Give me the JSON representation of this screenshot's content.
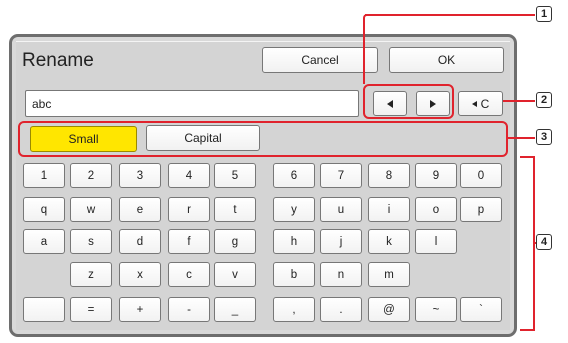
{
  "dialog": {
    "title": "Rename",
    "cancel_label": "Cancel",
    "ok_label": "OK"
  },
  "input": {
    "value": "abc"
  },
  "controls": {
    "clear_label": "C",
    "case_small_label": "Small",
    "case_capital_label": "Capital"
  },
  "keyboard": {
    "rows": [
      [
        "1",
        "2",
        "3",
        "4",
        "5",
        "6",
        "7",
        "8",
        "9",
        "0"
      ],
      [
        "q",
        "w",
        "e",
        "r",
        "t",
        "y",
        "u",
        "i",
        "o",
        "p"
      ],
      [
        "a",
        "s",
        "d",
        "f",
        "g",
        "h",
        "j",
        "k",
        "l"
      ],
      [
        "z",
        "x",
        "c",
        "v",
        "b",
        "n",
        "m"
      ],
      [
        "=",
        "+",
        "-",
        "_",
        ",",
        ".",
        "@",
        "~",
        "`"
      ]
    ]
  },
  "callouts": [
    "1",
    "2",
    "3",
    "4"
  ],
  "colors": {
    "selected": "#ffe600",
    "callout": "#e0232d"
  }
}
